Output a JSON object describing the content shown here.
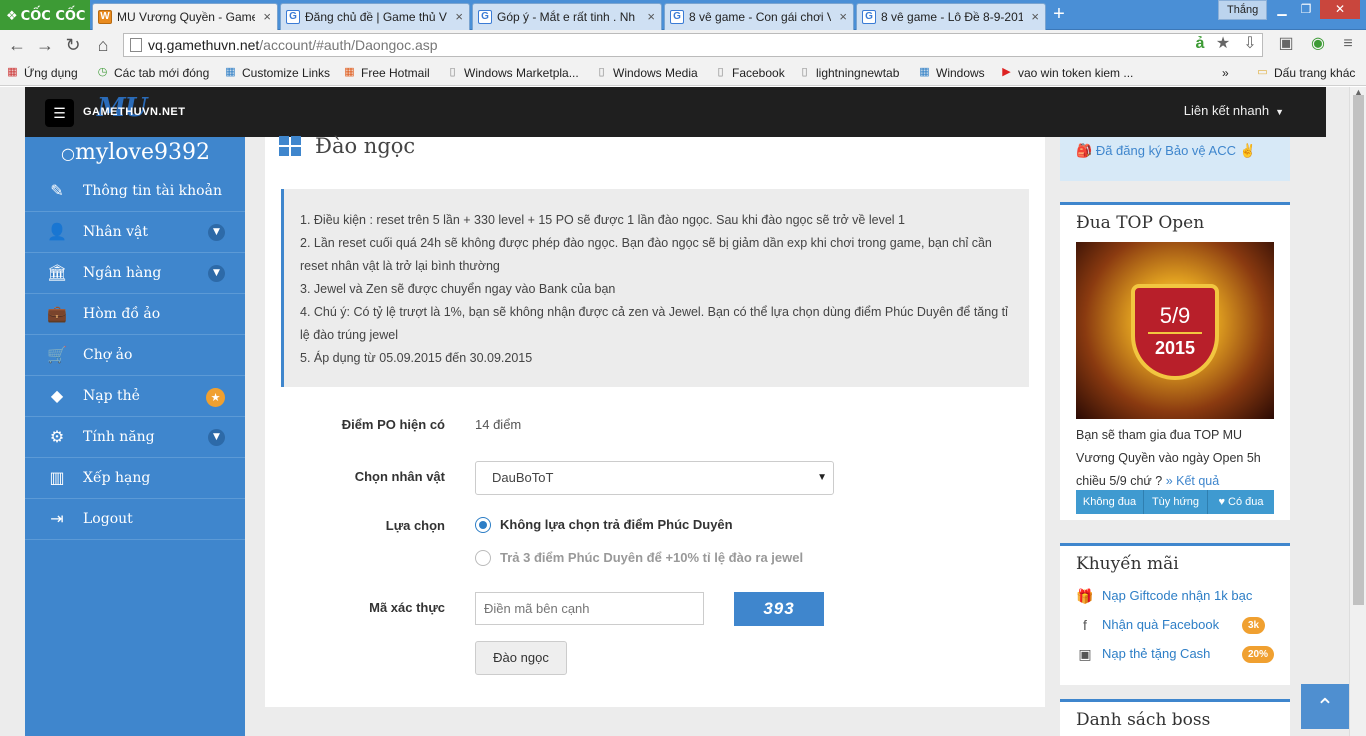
{
  "browser": {
    "brand": "CỐC CỐC",
    "user": "Thắng",
    "tabs": [
      {
        "title": "MU Vương Quyền - Game",
        "icon": "mu"
      },
      {
        "title": "Đăng chủ đề | Game thủ V",
        "icon": "G"
      },
      {
        "title": "Góp ý - Mắt e rất tinh . Nh",
        "icon": "G"
      },
      {
        "title": "8 vê game - Con gái chơi V",
        "icon": "G"
      },
      {
        "title": "8 vê game - Lô Đề 8-9-201",
        "icon": "G"
      }
    ],
    "url_host": "vq.gamethuvn.net",
    "url_path": "/account/#auth/Daongoc.asp",
    "bookmarks": [
      "Ứng dụng",
      "Các tab mới đóng",
      "Customize Links",
      "Free Hotmail",
      "Windows Marketpla...",
      "Windows Media",
      "Facebook",
      "lightningnewtab",
      "Windows",
      "vao win token kiem ..."
    ],
    "bookmarks_more": "»",
    "bookmarks_folder": "Dấu trang khác"
  },
  "header": {
    "logo_mu": "MU",
    "logo_text": "GAMETHUVN.NET",
    "quick_links": "Liên kết nhanh"
  },
  "sidebar": {
    "username": "mylove9392",
    "items": [
      {
        "label": "Thông tin tài khoản",
        "icon": "✎"
      },
      {
        "label": "Nhân vật",
        "icon": "👤"
      },
      {
        "label": "Ngân hàng",
        "icon": "🏛"
      },
      {
        "label": "Hòm đồ ảo",
        "icon": "💼"
      },
      {
        "label": "Chợ ảo",
        "icon": "🛒"
      },
      {
        "label": "Nạp thẻ",
        "icon": "◆"
      },
      {
        "label": "Tính năng",
        "icon": "⚙"
      },
      {
        "label": "Xếp hạng",
        "icon": "▥"
      },
      {
        "label": "Logout",
        "icon": "⇥"
      }
    ]
  },
  "main": {
    "title": "Đào ngọc",
    "notes": [
      "1. Điều kiện : reset trên 5 lần + 330 level + 15 PO sẽ được 1 lần đào ngọc. Sau khi đào ngọc sẽ trở về level 1",
      "2. Lần reset cuối quá 24h sẽ không được phép đào ngọc. Bạn đào ngọc sẽ bị giảm dần exp khi chơi trong game, bạn chỉ cần reset nhân vật là trở lại bình thường",
      "3. Jewel và Zen sẽ được chuyển ngay vào Bank của bạn",
      "4. Chú ý: Có tỷ lệ trượt là 1%, bạn sẽ không nhận được cả zen và Jewel. Bạn có thể lựa chọn dùng điểm Phúc Duyên để tăng tỉ lệ đào trúng jewel",
      "5. Áp dụng từ 05.09.2015 đến 30.09.2015"
    ],
    "po_label": "Điểm PO hiện có",
    "po_value": "14 điểm",
    "char_label": "Chọn nhân vật",
    "char_value": "DauBoToT",
    "choice_label": "Lựa chọn",
    "option1": "Không lựa chọn trả điểm Phúc Duyên",
    "option2": "Trả 3 điểm Phúc Duyên để +10% tỉ lệ đào ra jewel",
    "captcha_label": "Mã xác thực",
    "captcha_placeholder": "Điền mã bên cạnh",
    "captcha_code": "393",
    "submit": "Đào ngọc"
  },
  "right": {
    "protect": "Đã đăng ký Bảo vệ ACC ✌",
    "top_title": "Đua TOP Open",
    "top_img_date": "5/9",
    "top_img_year": "2015",
    "top_desc": "Bạn sẽ tham gia đua TOP MU Vương Quyền vào ngày Open 5h chiều 5/9 chứ ?",
    "top_link": "» Kết quả",
    "top_buttons": [
      "Không đua",
      "Tùy hứng",
      "♥ Có đua"
    ],
    "promo_title": "Khuyến mãi",
    "promos": [
      {
        "label": "Nạp Giftcode nhận 1k bạc",
        "icon": "🎁",
        "badge": ""
      },
      {
        "label": "Nhận quà Facebook",
        "icon": "f",
        "badge": "3k"
      },
      {
        "label": "Nạp thẻ tặng Cash",
        "icon": "▣",
        "badge": "20%"
      }
    ],
    "boss_title": "Danh sách boss"
  }
}
